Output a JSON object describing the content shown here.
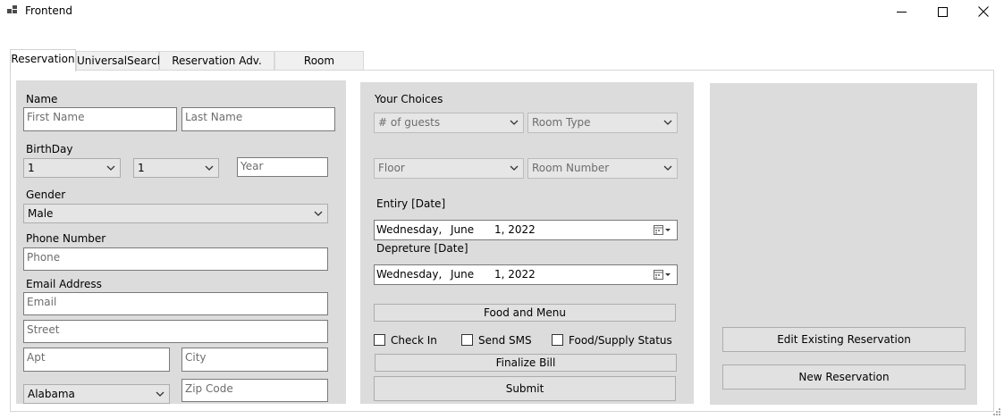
{
  "window": {
    "title": "Frontend",
    "app_icon": "app-grid-icon",
    "minimize_icon": "minimize-icon",
    "maximize_icon": "maximize-icon",
    "close_icon": "close-icon"
  },
  "tabs": [
    {
      "label": "Reservation",
      "active": true
    },
    {
      "label": "UniversalSearch",
      "active": false
    },
    {
      "label": "Reservation Adv. View",
      "active": false
    },
    {
      "label": "Room Availibility",
      "active": false
    }
  ],
  "guest": {
    "name_label": "Name",
    "first_name_placeholder": "First Name",
    "last_name_placeholder": "Last Name",
    "birthday_label": "BirthDay",
    "birth_month_value": "1",
    "birth_day_value": "1",
    "year_placeholder": "Year",
    "gender_label": "Gender",
    "gender_value": "Male",
    "phone_label": "Phone Number",
    "phone_placeholder": "Phone",
    "email_label": "Email Address",
    "email_placeholder": "Email",
    "street_placeholder": "Street",
    "apt_placeholder": "Apt",
    "city_placeholder": "City",
    "state_value": "Alabama",
    "zip_placeholder": "Zip Code"
  },
  "choices": {
    "label": "Your Choices",
    "guests_placeholder": "# of guests",
    "room_type_placeholder": "Room Type",
    "floor_placeholder": "Floor",
    "room_number_placeholder": "Room Number",
    "entry_label": "Entiry [Date]",
    "entry_date": {
      "weekday": "Wednesday,",
      "month": "June",
      "day_year": "1, 2022"
    },
    "departure_label": "Depreture [Date]",
    "departure_date": {
      "weekday": "Wednesday,",
      "month": "June",
      "day_year": "1, 2022"
    },
    "calendar_icon": "calendar-icon",
    "food_menu_button": "Food and Menu",
    "check_in_label": "Check In",
    "send_sms_label": "Send SMS",
    "food_supply_label": "Food/Supply Status",
    "finalize_bill_button": "Finalize Bill",
    "submit_button": "Submit"
  },
  "actions": {
    "edit_existing_button": "Edit Existing Reservation",
    "new_reservation_button": "New Reservation"
  },
  "colors": {
    "panel_bg": "#dcdcdc",
    "button_bg": "#e1e1e1",
    "input_border": "#7a7a7a"
  }
}
